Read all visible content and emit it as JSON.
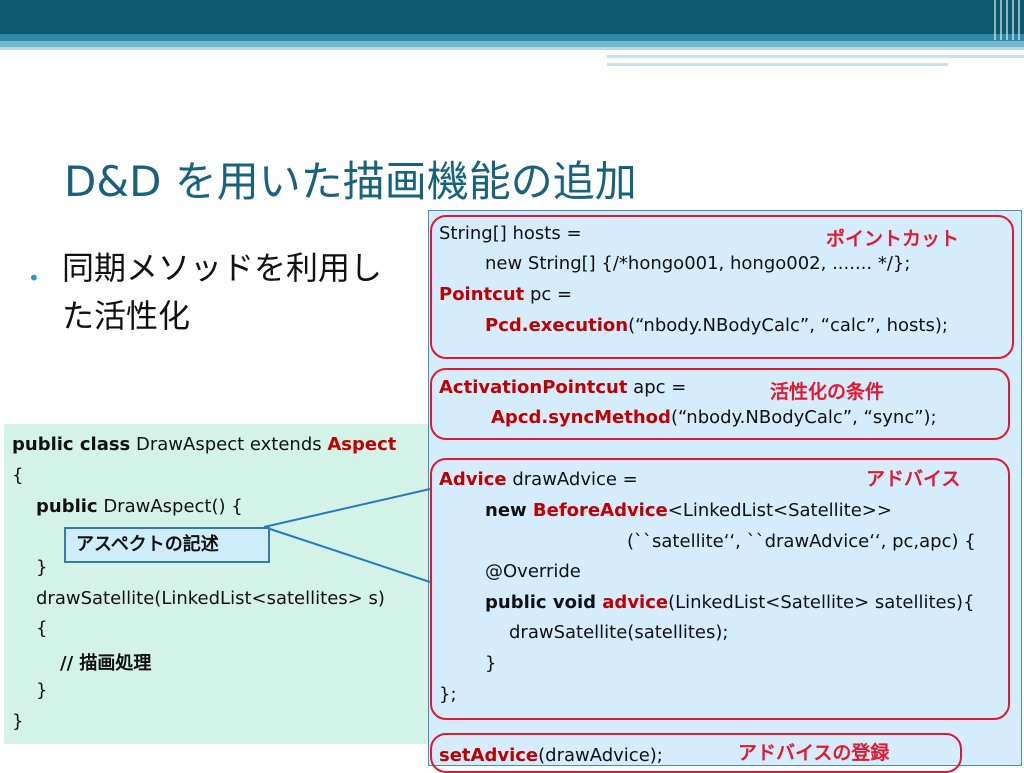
{
  "slide": {
    "title": "D&D を用いた描画機能の追加",
    "bullet": "同期メソッドを利用した活性化",
    "bullet_line1": "同期メソッドを利用し",
    "bullet_line2": "た活性化"
  },
  "left_code": {
    "l1_kw": "public class",
    "l1_mid": " DrawAspect extends ",
    "l1_red": "Aspect",
    "l2": "{",
    "l3_kw": "public",
    "l3_rest": " DrawAspect() {",
    "l4": "}",
    "l5": "drawSatellite(LinkedList<satellites> s)",
    "l6": "{",
    "l7": "// 描画処理",
    "l8": "}",
    "l9": "}",
    "callout": "アスペクトの記述"
  },
  "right_code": {
    "r1": "String[] hosts =",
    "r2": "new String[] {/*hongo001, hongo002, ....... */};",
    "r3_red": "Pointcut",
    "r3_rest": " pc =",
    "r4_red": "Pcd.execution",
    "r4_rest": "(“nbody.NBodyCalc”, “calc”, hosts);",
    "r5_red": "ActivationPointcut",
    "r5_rest": " apc =",
    "r6_red": "Apcd.syncMethod",
    "r6_rest": "(“nbody.NBodyCalc”, “sync”);",
    "r7_red": "Advice",
    "r7_rest": " drawAdvice =",
    "r8_kw": "new ",
    "r8_red": "BeforeAdvice",
    "r8_rest": "<LinkedList<Satellite>>",
    "r9": "(``satellite‘‘, ``drawAdvice‘‘, pc,apc) {",
    "r10": "@Override",
    "r11_kw": "public void ",
    "r11_red": "advice",
    "r11_rest": "(LinkedList<Satellite> satellites){",
    "r12": "drawSatellite(satellites);",
    "r13": "}",
    "r14": "};",
    "r15_red": "setAdvice",
    "r15_rest": "(drawAdvice);"
  },
  "annotations": {
    "pointcut": "ポイントカット",
    "activation": "活性化の条件",
    "advice": "アドバイス",
    "register": "アドバイスの登録"
  },
  "colors": {
    "title": "#17637e",
    "highlight": "#c00000",
    "frame": "#e01830"
  }
}
